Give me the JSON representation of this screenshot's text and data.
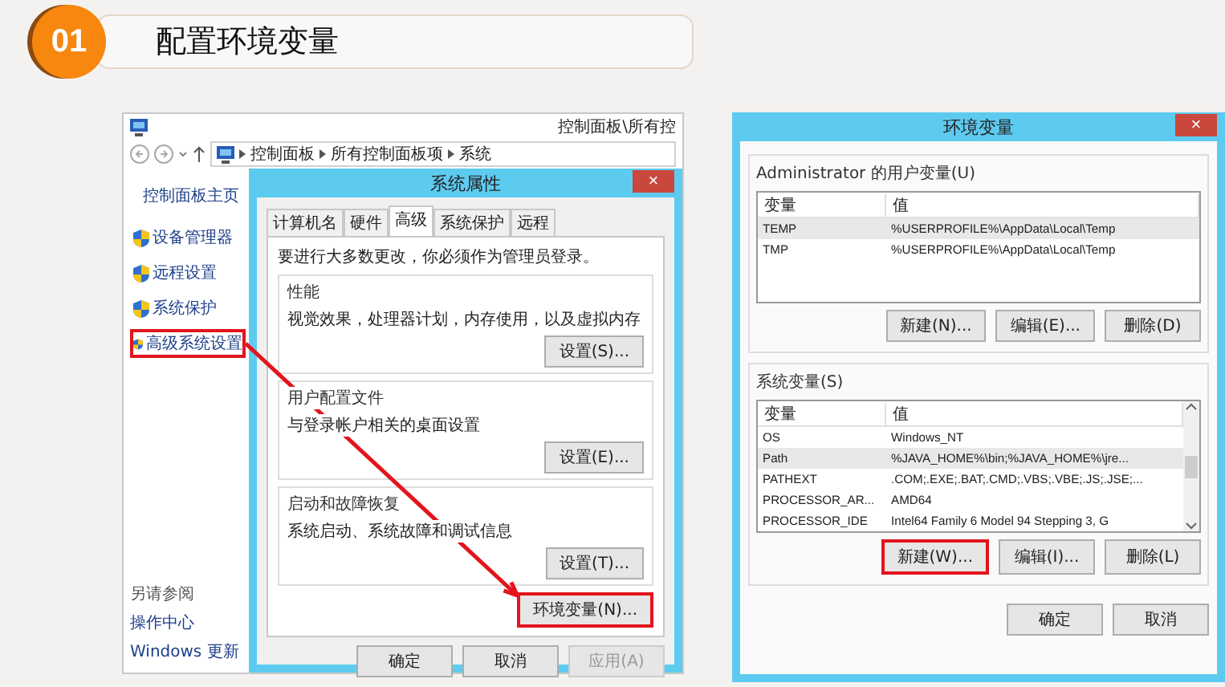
{
  "slide": {
    "number": "01",
    "title": "配置环境变量"
  },
  "control_panel": {
    "title": "控制面板\\所有控",
    "breadcrumb": [
      "控制面板",
      "所有控制面板项",
      "系统"
    ],
    "sidebar": {
      "home": "控制面板主页",
      "items": [
        {
          "label": "设备管理器",
          "highlighted": false
        },
        {
          "label": "远程设置",
          "highlighted": false
        },
        {
          "label": "系统保护",
          "highlighted": false
        },
        {
          "label": "高级系统设置",
          "highlighted": true
        }
      ],
      "see_also": {
        "heading": "另请参阅",
        "items": [
          "操作中心",
          "Windows 更新"
        ]
      }
    }
  },
  "system_properties": {
    "title": "系统属性",
    "close": "×",
    "tabs": [
      {
        "label": "计算机名",
        "selected": false
      },
      {
        "label": "硬件",
        "selected": false
      },
      {
        "label": "高级",
        "selected": true
      },
      {
        "label": "系统保护",
        "selected": false
      },
      {
        "label": "远程",
        "selected": false
      }
    ],
    "notice": "要进行大多数更改，你必须作为管理员登录。",
    "groups": [
      {
        "title": "性能",
        "description": "视觉效果，处理器计划，内存使用，以及虚拟内存",
        "button": {
          "label": "设置(S)...",
          "highlighted": false
        }
      },
      {
        "title": "用户配置文件",
        "description": "与登录帐户相关的桌面设置",
        "button": {
          "label": "设置(E)...",
          "highlighted": false
        }
      },
      {
        "title": "启动和故障恢复",
        "description": "系统启动、系统故障和调试信息",
        "button": {
          "label": "设置(T)...",
          "highlighted": false
        }
      }
    ],
    "env_button": {
      "label": "环境变量(N)...",
      "highlighted": true
    },
    "buttons": [
      {
        "label": "确定",
        "disabled": false
      },
      {
        "label": "取消",
        "disabled": false
      },
      {
        "label": "应用(A)",
        "disabled": true
      }
    ]
  },
  "environment_variables": {
    "title": "环境变量",
    "close": "×",
    "groups": [
      {
        "title": "Administrator 的用户变量(U)",
        "columns": [
          "变量",
          "值"
        ],
        "scrollbar": false,
        "rows": [
          {
            "cells": [
              "TEMP",
              "%USERPROFILE%\\AppData\\Local\\Temp"
            ],
            "selected": true
          },
          {
            "cells": [
              "TMP",
              "%USERPROFILE%\\AppData\\Local\\Temp"
            ],
            "selected": false
          }
        ],
        "buttons": [
          {
            "label": "新建(N)...",
            "highlighted": false
          },
          {
            "label": "编辑(E)...",
            "highlighted": false
          },
          {
            "label": "删除(D)",
            "highlighted": false
          }
        ]
      },
      {
        "title": "系统变量(S)",
        "columns": [
          "变量",
          "值"
        ],
        "scrollbar": true,
        "rows": [
          {
            "cells": [
              "OS",
              "Windows_NT"
            ],
            "selected": false
          },
          {
            "cells": [
              "Path",
              "%JAVA_HOME%\\bin;%JAVA_HOME%\\jre..."
            ],
            "selected": true
          },
          {
            "cells": [
              "PATHEXT",
              ".COM;.EXE;.BAT;.CMD;.VBS;.VBE;.JS;.JSE;..."
            ],
            "selected": false
          },
          {
            "cells": [
              "PROCESSOR_AR...",
              "AMD64"
            ],
            "selected": false
          },
          {
            "cells": [
              "PROCESSOR_IDE",
              "Intel64 Family 6 Model 94 Stepping 3, G"
            ],
            "selected": false
          }
        ],
        "buttons": [
          {
            "label": "新建(W)...",
            "highlighted": true
          },
          {
            "label": "编辑(I)...",
            "highlighted": false
          },
          {
            "label": "删除(L)",
            "highlighted": false
          }
        ]
      }
    ],
    "buttons": [
      {
        "label": "确定",
        "disabled": false
      },
      {
        "label": "取消",
        "disabled": false
      }
    ]
  }
}
